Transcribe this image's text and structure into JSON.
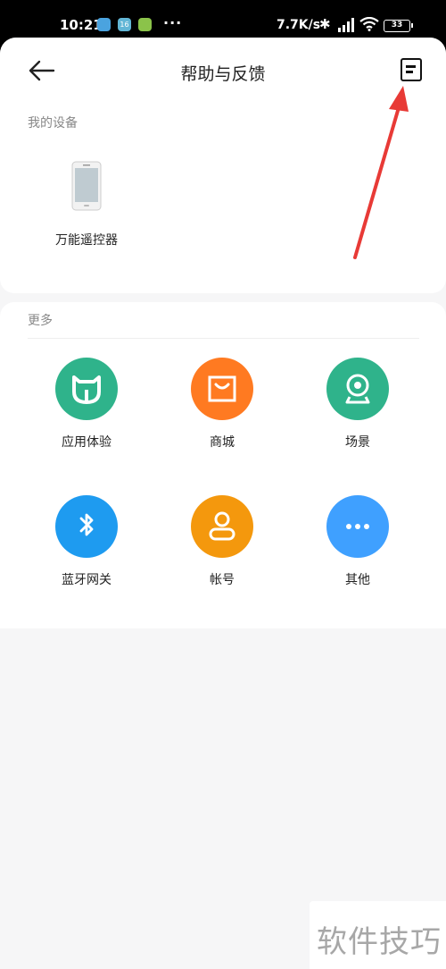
{
  "status_bar": {
    "time": "10:21",
    "notif_badge": "16",
    "more_dots": "···",
    "net_speed": "7.7K/s",
    "battery": "33"
  },
  "header": {
    "title": "帮助与反馈"
  },
  "my_devices": {
    "label": "我的设备",
    "items": [
      {
        "name": "万能遥控器"
      }
    ]
  },
  "more": {
    "label": "更多",
    "items": [
      {
        "label": "应用体验",
        "icon": "mijia-icon",
        "color": "#2fb38b"
      },
      {
        "label": "商城",
        "icon": "shop-bag-icon",
        "color": "#ff7a21"
      },
      {
        "label": "场景",
        "icon": "camera-icon",
        "color": "#2fb38b"
      },
      {
        "label": "蓝牙网关",
        "icon": "bluetooth-icon",
        "color": "#1e9bf0"
      },
      {
        "label": "帐号",
        "icon": "account-icon",
        "color": "#f4980d"
      },
      {
        "label": "其他",
        "icon": "more-icon",
        "color": "#3fa0ff"
      }
    ]
  },
  "annotation": {
    "color": "#e83a36"
  },
  "watermark": "软件技巧"
}
